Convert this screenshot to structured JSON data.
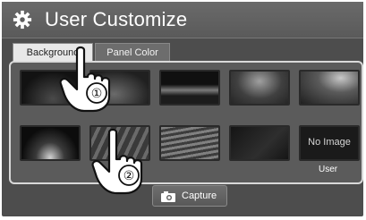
{
  "header": {
    "title": "User Customize",
    "icon": "gear-icon"
  },
  "tabs": [
    {
      "label": "Background",
      "active": true
    },
    {
      "label": "Panel Color",
      "active": false
    }
  ],
  "thumbnails": {
    "row1": [
      "image-1",
      "image-2",
      "image-3",
      "image-4",
      "image-5"
    ],
    "row2": [
      "image-6",
      "image-7",
      "image-8",
      "image-9",
      "no-image-slot"
    ],
    "no_image_text": "No Image",
    "user_label": "User"
  },
  "capture_button": {
    "label": "Capture",
    "icon": "camera-icon"
  },
  "callouts": [
    {
      "marker": "①"
    },
    {
      "marker": "②"
    }
  ],
  "colors": {
    "screen_bg": "#4d4d4d",
    "panel_border": "#d9d9d9",
    "active_tab_bg": "#e8e8e8",
    "text": "#ffffff"
  }
}
